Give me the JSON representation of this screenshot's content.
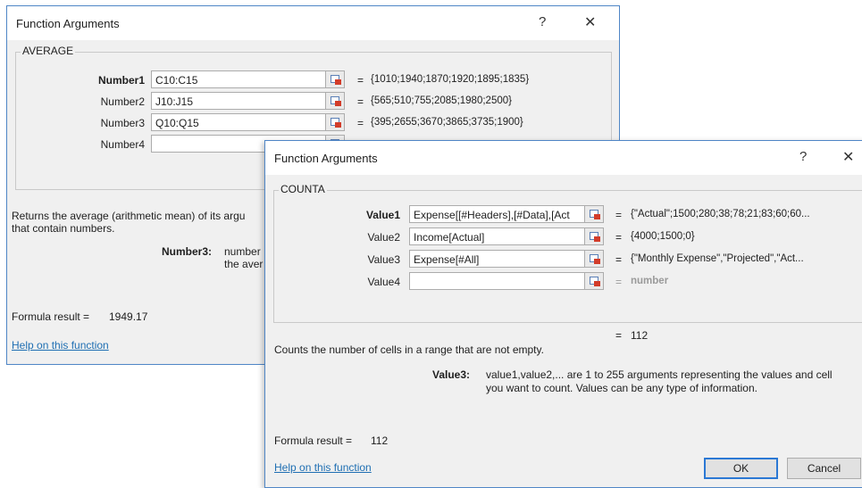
{
  "dialog1": {
    "title": "Function Arguments",
    "help": "?",
    "close": "✕",
    "function_name": "AVERAGE",
    "args": [
      {
        "label": "Number1",
        "value": "C10:C15",
        "eq": "=",
        "result": "{1010;1940;1870;1920;1895;1835}"
      },
      {
        "label": "Number2",
        "value": "J10:J15",
        "eq": "=",
        "result": "{565;510;755;2085;1980;2500}"
      },
      {
        "label": "Number3",
        "value": "Q10:Q15",
        "eq": "=",
        "result": "{395;2655;3670;3865;3735;1900}"
      },
      {
        "label": "Number4",
        "value": "",
        "eq": "",
        "result": ""
      }
    ],
    "description_line1": "Returns the average (arithmetic mean) of its argu",
    "description_line2": "that contain numbers.",
    "arg_help_label": "Number3:",
    "arg_help_line1": "number",
    "arg_help_line2": "the aver",
    "formula_result_label": "Formula result =",
    "formula_result_value": "1949.17",
    "help_link": "Help on this function"
  },
  "dialog2": {
    "title": "Function Arguments",
    "help": "?",
    "close": "✕",
    "function_name": "COUNTA",
    "args": [
      {
        "label": "Value1",
        "value": "Expense[[#Headers],[#Data],[Act",
        "eq": "=",
        "result": "{\"Actual\";1500;280;38;78;21;83;60;60..."
      },
      {
        "label": "Value2",
        "value": "Income[Actual]",
        "eq": "=",
        "result": "{4000;1500;0}"
      },
      {
        "label": "Value3",
        "value": "Expense[#All]",
        "eq": "=",
        "result": "{\"Monthly Expense\",\"Projected\",\"Act..."
      },
      {
        "label": "Value4",
        "value": "",
        "eq": "=",
        "result": "number"
      }
    ],
    "overall_eq": "=",
    "overall_result": "112",
    "description": "Counts the number of cells in a range that are not empty.",
    "arg_help_label": "Value3:",
    "arg_help_line1": "value1,value2,... are 1 to 255 arguments representing the values and cell",
    "arg_help_line2": "you want to count. Values can be any type of information.",
    "formula_result_label": "Formula result =",
    "formula_result_value": "112",
    "help_link": "Help on this function",
    "ok_label": "OK",
    "cancel_label": "Cancel"
  }
}
